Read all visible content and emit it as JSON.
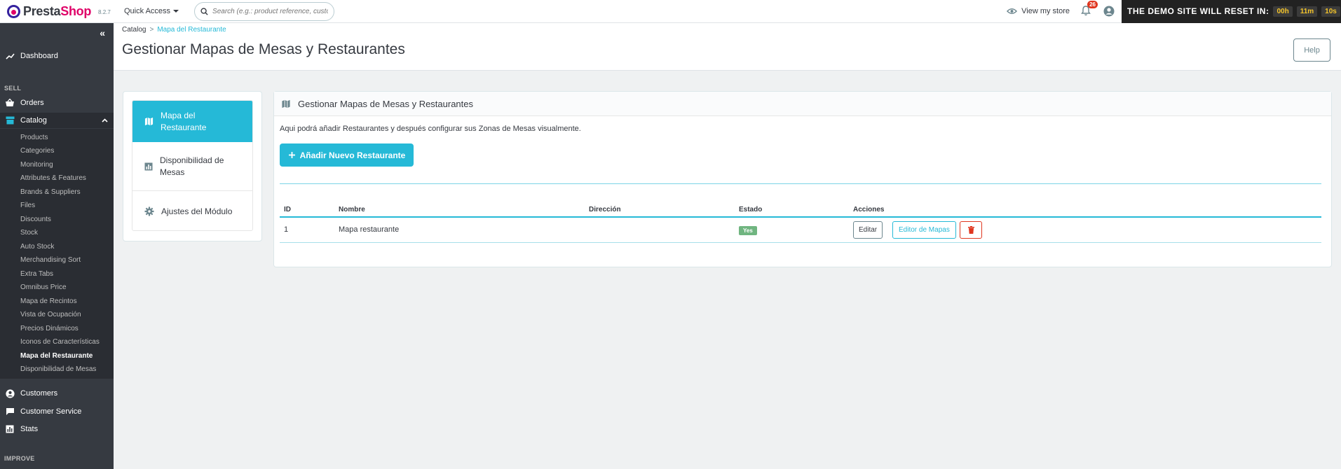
{
  "header": {
    "logo_part1": "Presta",
    "logo_part2": "Shop",
    "version": "8.2.7",
    "quick_access": "Quick Access",
    "search_placeholder": "Search (e.g.: product reference, custon",
    "view_store": "View my store",
    "notifications_count": "26",
    "demo_text": "THE DEMO SITE WILL RESET IN:",
    "timer_hours": "00h",
    "timer_minutes": "11m",
    "timer_seconds": "10s"
  },
  "sidebar": {
    "dashboard": "Dashboard",
    "sell_label": "SELL",
    "orders": "Orders",
    "catalog": "Catalog",
    "catalog_items": [
      "Products",
      "Categories",
      "Monitoring",
      "Attributes & Features",
      "Brands & Suppliers",
      "Files",
      "Discounts",
      "Stock",
      "Auto Stock",
      "Merchandising Sort",
      "Extra Tabs",
      "Omnibus Price",
      "Mapa de Recintos",
      "Vista de Ocupación",
      "Precios Dinámicos",
      "Iconos de Características",
      "Mapa del Restaurante",
      "Disponibilidad de Mesas"
    ],
    "current_item": "Mapa del Restaurante",
    "customers": "Customers",
    "customer_service": "Customer Service",
    "stats": "Stats",
    "improve_label": "IMPROVE"
  },
  "breadcrumb": {
    "parent": "Catalog",
    "separator": ">",
    "current": "Mapa del Restaurante"
  },
  "page": {
    "title": "Gestionar Mapas de Mesas y Restaurantes",
    "help": "Help"
  },
  "tabs": [
    {
      "line1": "Mapa del",
      "line2": "Restaurante",
      "icon": "map-icon"
    },
    {
      "line1": "Disponibilidad de",
      "line2": "Mesas",
      "icon": "chart-icon"
    },
    {
      "line1": "Ajustes del Módulo",
      "line2": "",
      "icon": "gear-icon"
    }
  ],
  "panel": {
    "heading": "Gestionar Mapas de Mesas y Restaurantes",
    "intro": "Aqui podrá añadir Restaurantes y después configurar sus Zonas de Mesas visualmente.",
    "add_button": "Añadir Nuevo Restaurante"
  },
  "table": {
    "headers": [
      "ID",
      "Nombre",
      "Dirección",
      "Estado",
      "Acciones"
    ],
    "rows": [
      {
        "id": "1",
        "nombre": "Mapa restaurante",
        "direccion": "",
        "estado": "Yes",
        "edit": "Editar",
        "map_editor": "Editor de Mapas"
      }
    ]
  },
  "colors": {
    "primary": "#25b9d7",
    "sidebar_bg": "#363a41",
    "brand_pink": "#df0067",
    "danger": "#e0361f",
    "success": "#70b580"
  }
}
